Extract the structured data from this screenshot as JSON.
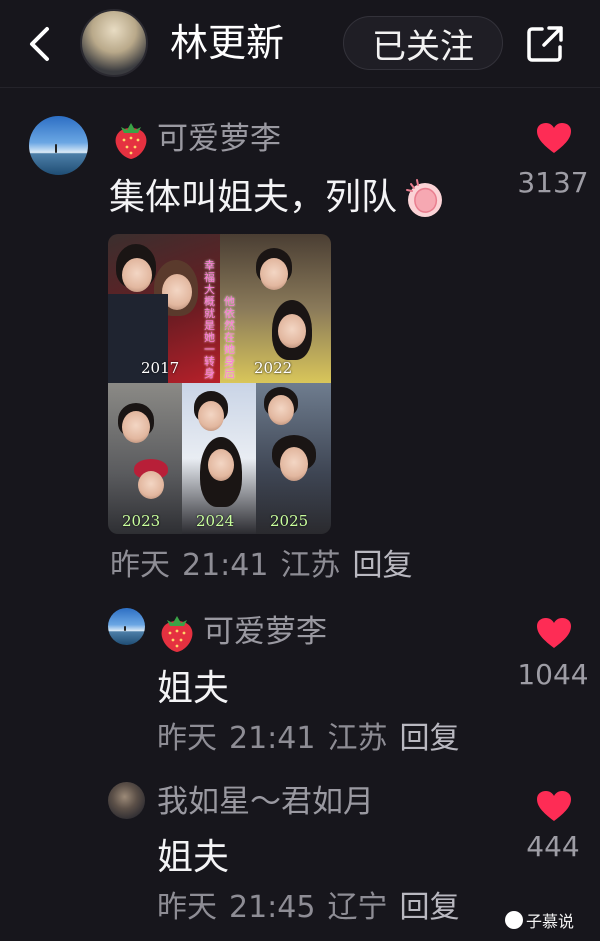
{
  "header": {
    "name": "林更新",
    "follow_label": "已关注",
    "back_icon": "chevron-left-icon",
    "share_icon": "share-out-icon"
  },
  "comment": {
    "username": "可爱萝李",
    "text": "集体叫姐夫，列队",
    "likes": "3137",
    "date": "昨天",
    "time": "21:41",
    "location": "江苏",
    "reply_label": "回复",
    "collage_years": [
      "2017",
      "2022",
      "2023",
      "2024",
      "2025"
    ],
    "collage_caption_left": "幸福大概就是她一转身",
    "collage_caption_right": "他依然在她身后"
  },
  "replies": [
    {
      "username": "可爱萝李",
      "text": "姐夫",
      "likes": "1044",
      "date": "昨天",
      "time": "21:41",
      "location": "江苏",
      "reply_label": "回复"
    },
    {
      "username": "我如星～君如月",
      "text": "姐夫",
      "likes": "444",
      "date": "昨天",
      "time": "21:45",
      "location": "辽宁",
      "reply_label": "回复"
    }
  ],
  "watermark": "子慕说",
  "colors": {
    "background": "#17161c",
    "heart": "#fe2c55",
    "muted_text": "#8e8d95"
  }
}
